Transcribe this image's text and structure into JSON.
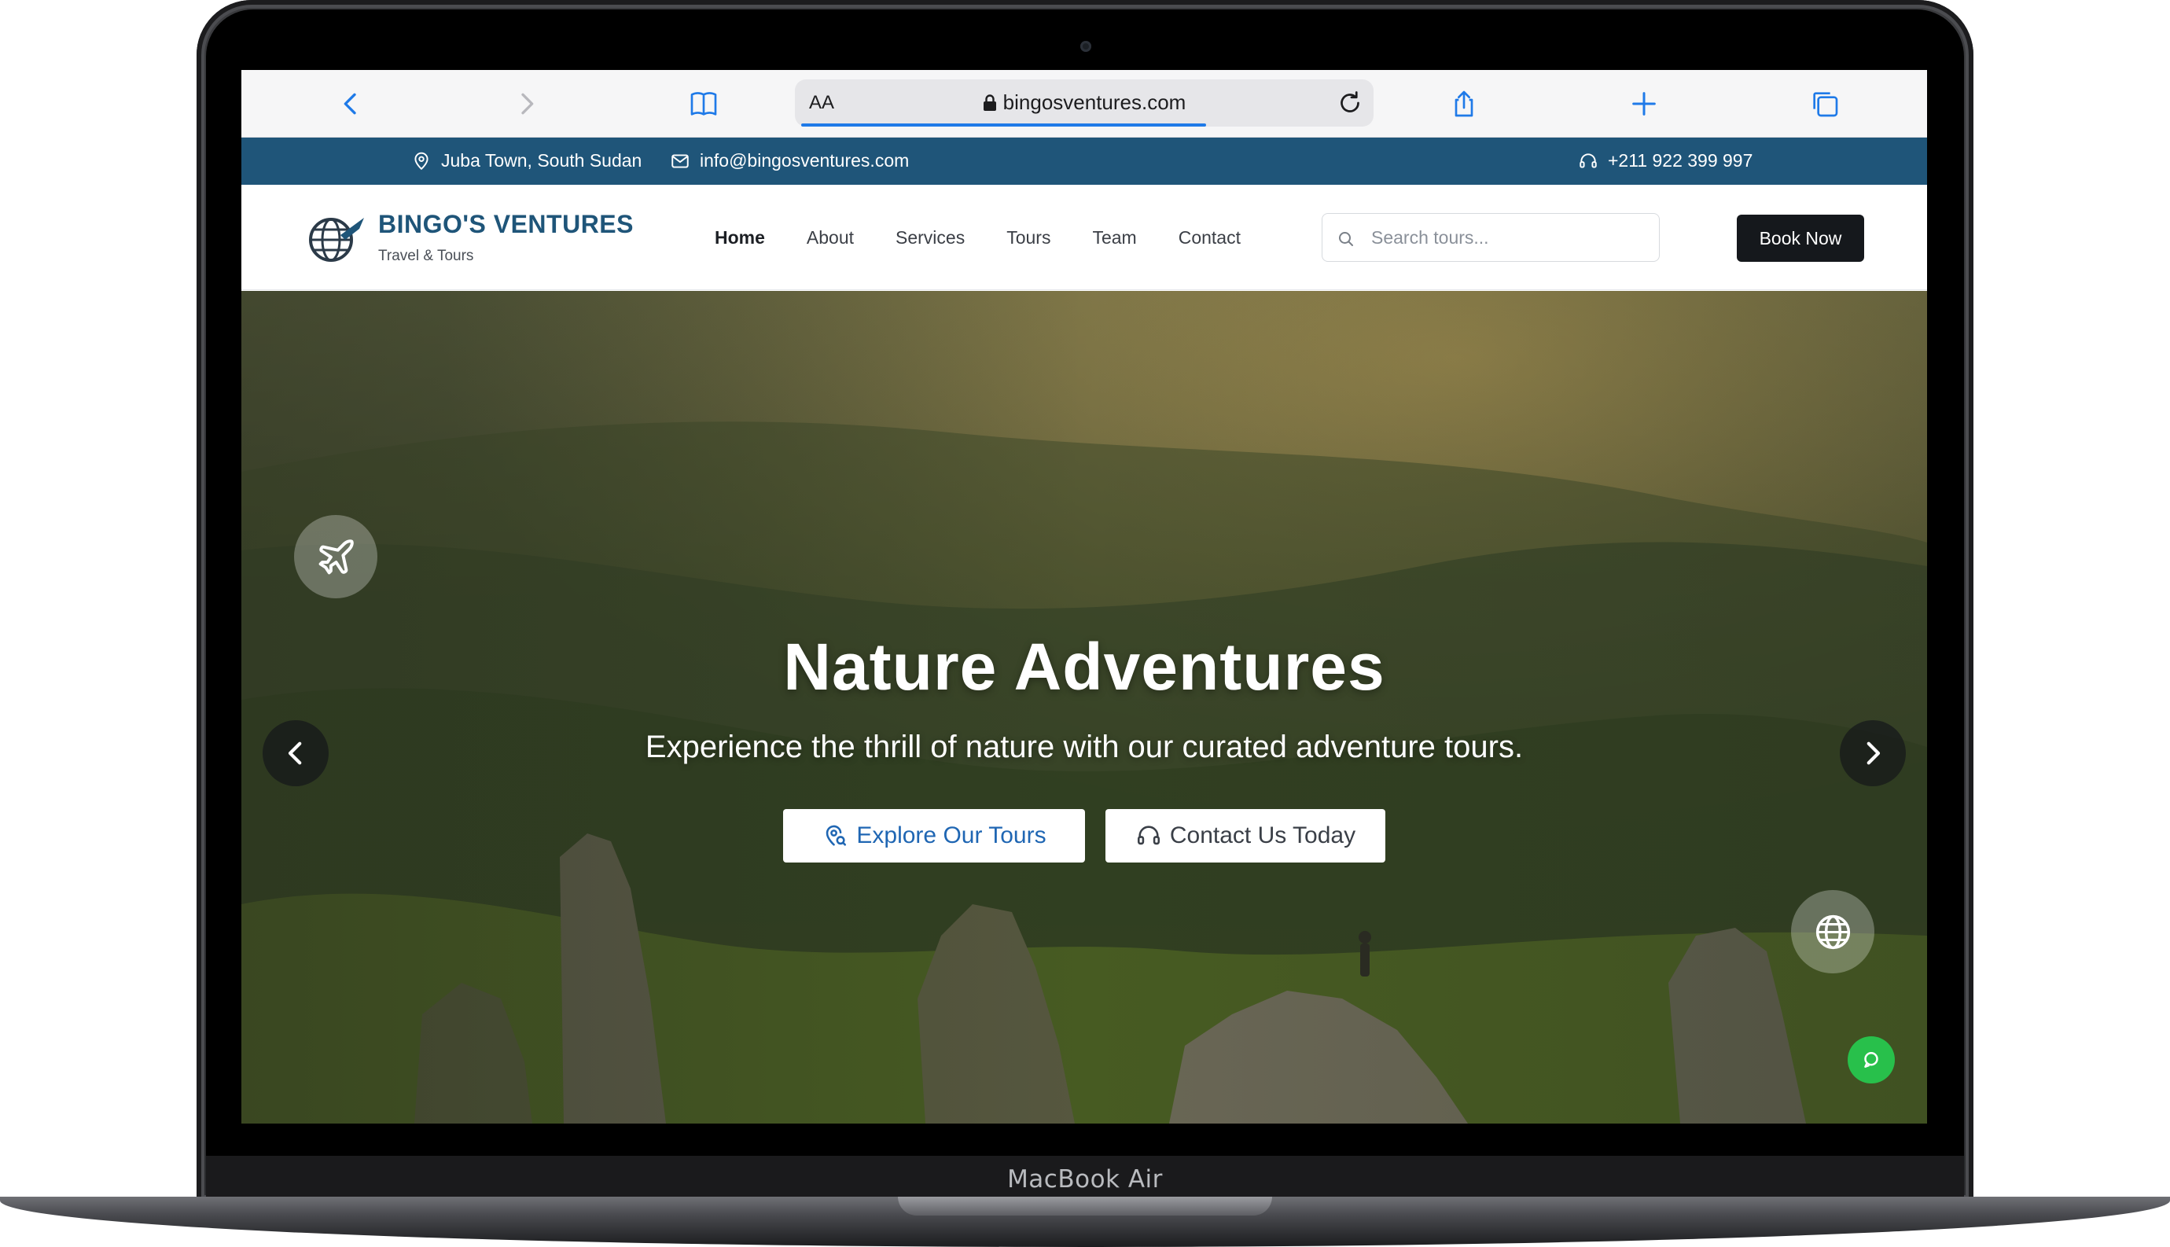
{
  "device": {
    "label": "MacBook Air"
  },
  "browser": {
    "text_size_label": "AA",
    "url": "bingosventures.com",
    "page_load_progress": 0.7
  },
  "info_bar": {
    "location": "Juba Town, South Sudan",
    "email": "info@bingosventures.com",
    "phone": "+211 922 399 997",
    "background_color": "#1f5579"
  },
  "header": {
    "brand_name": "BINGO'S VENTURES",
    "brand_tagline": "Travel & Tours",
    "nav": [
      {
        "label": "Home",
        "active": true
      },
      {
        "label": "About",
        "active": false
      },
      {
        "label": "Services",
        "active": false
      },
      {
        "label": "Tours",
        "active": false
      },
      {
        "label": "Team",
        "active": false
      },
      {
        "label": "Contact",
        "active": false
      }
    ],
    "search_placeholder": "Search tours...",
    "book_button": "Book Now"
  },
  "hero": {
    "title": "Nature Adventures",
    "subtitle": "Experience the thrill of nature with our curated adventure tours.",
    "primary_button": "Explore Our Tours",
    "secondary_button": "Contact Us Today",
    "icons": [
      "plane-icon",
      "chevron-left-icon",
      "chevron-right-icon",
      "globe-icon",
      "chat-icon"
    ]
  },
  "colors": {
    "brand_blue": "#1f5579",
    "link_blue": "#1f66b3",
    "chat_green": "#28c04b",
    "book_button": "#15181c"
  }
}
